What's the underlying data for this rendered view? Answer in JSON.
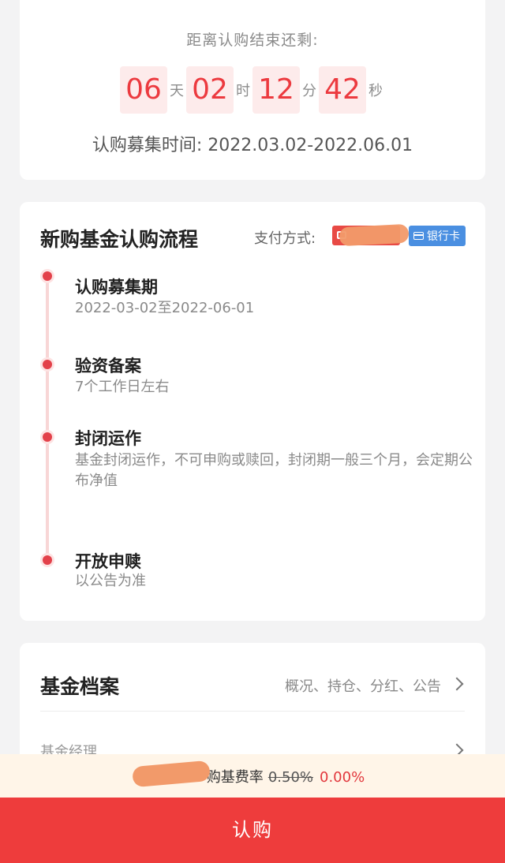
{
  "countdown": {
    "title": "距离认购结束还剩:",
    "days": "06",
    "days_unit": "天",
    "hours": "02",
    "hours_unit": "时",
    "minutes": "12",
    "minutes_unit": "分",
    "seconds": "42",
    "seconds_unit": "秒",
    "period_label": "认购募集时间:",
    "period_value": "2022.03.02-2022.06.01"
  },
  "process": {
    "title": "新购基金认购流程",
    "pay_label": "支付方式:",
    "pay_bank_label": "银行卡",
    "steps": [
      {
        "title": "认购募集期",
        "desc": "2022-03-02至2022-06-01"
      },
      {
        "title": "验资备案",
        "desc": "7个工作日左右"
      },
      {
        "title": "封闭运作",
        "desc": "基金封闭运作，不可申购或赎回，封闭期一般三个月，会定期公布净值"
      },
      {
        "title": "开放申赎",
        "desc": "以公告为准"
      }
    ]
  },
  "fund_file": {
    "title": "基金档案",
    "links": "概况、持仓、分红、公告",
    "manager_label": "基金经理"
  },
  "fee": {
    "label": "购基费率",
    "old_rate": "0.50%",
    "new_rate": "0.00%"
  },
  "buy_button": "认购",
  "colors": {
    "accent": "#ee3c3c",
    "countdown_bg": "#fdebeb",
    "timeline": "#e3414a",
    "bank_badge": "#4a8fe1",
    "fee_bar": "#fff5e8"
  }
}
